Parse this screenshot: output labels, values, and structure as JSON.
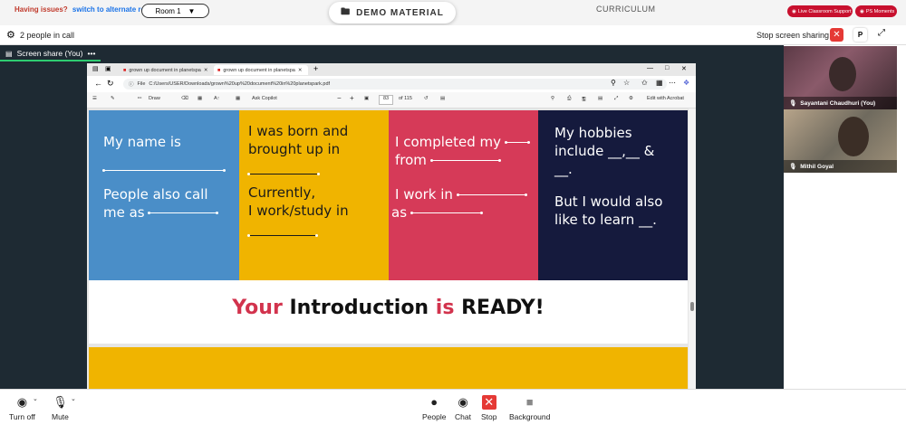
{
  "topbar": {
    "issues_text": "Having issues?",
    "alt_room_link": "switch to alternate room",
    "room_select": "Room 1",
    "demo_button": "DEMO MATERIAL",
    "curriculum": "CURRICULUM",
    "live_support": "Live Classroom Support",
    "ps_moments": "PS Moments"
  },
  "call": {
    "people_count": "2 people in call",
    "stop_sharing": "Stop screen sharing",
    "p_button": "P",
    "share_label": "Screen share (You)",
    "share_menu": "•••"
  },
  "browser": {
    "tabs": [
      {
        "label": "grown up document in planetspa"
      },
      {
        "label": "grown up document in planetspa"
      }
    ],
    "url_prefix": "File",
    "url": "C:/Users/USER/Downloads/grown%20up%20document%20in%20planetspark.pdf",
    "pdf_tools": {
      "draw": "Draw",
      "ask_copilot": "Ask Copilot",
      "zoom_minus": "−",
      "zoom_plus": "+",
      "page_current": "83",
      "page_total": "of 115",
      "edit_acrobat": "Edit with Acrobat"
    }
  },
  "slides": {
    "card1": {
      "line1": "My name is",
      "line2": "People also call",
      "line3": "me as"
    },
    "card2": {
      "line1": "I was born and",
      "line2": "brought up in",
      "line3": "Currently,",
      "line4": "I work/study in"
    },
    "card3": {
      "line1": "I completed my",
      "line2": "from",
      "line3": "I work in",
      "line4": "as"
    },
    "card4": {
      "line1": "My hobbies",
      "line2": "include __,__ &",
      "line3": "__.",
      "line4": "But I would also",
      "line5": "like to learn __."
    },
    "ready": {
      "w1": "Your",
      "w2": "Introduction",
      "w3": "is",
      "w4": "READY!"
    }
  },
  "participants": [
    {
      "name": "Sayantani Chaudhuri (You)"
    },
    {
      "name": "Mithil Goyal"
    }
  ],
  "controls": {
    "camera": "Turn off",
    "mic": "Mute",
    "people": "People",
    "chat": "Chat",
    "stop": "Stop",
    "background": "Background"
  },
  "colors": {
    "card_blue": "#4a8ec8",
    "card_yellow": "#f0b400",
    "card_pink": "#d63a58",
    "card_navy": "#151a3d",
    "accent_red": "#c8102e"
  }
}
